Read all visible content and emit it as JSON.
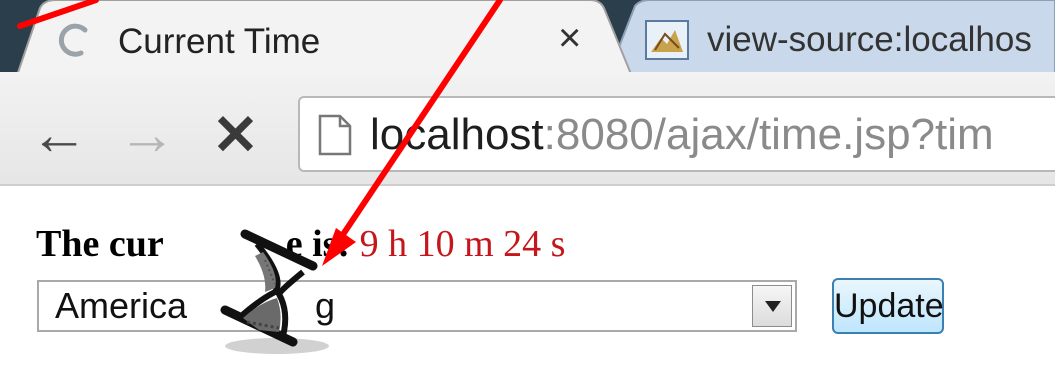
{
  "tabs": [
    {
      "title": "Current Time",
      "close_glyph": "×",
      "icon": "loading-spinner-icon"
    },
    {
      "title": "view-source:localhos",
      "icon": "page-favicon-icon"
    }
  ],
  "toolbar": {
    "back_glyph": "←",
    "forward_glyph": "→",
    "stop_glyph": "✕",
    "url_host": "localhost",
    "url_rest": ":8080/ajax/time.jsp?tim"
  },
  "page": {
    "time_label": "The cur",
    "time_label_tail": "e is:",
    "time_value": "9 h 10 m 24 s",
    "timezone_select_value": "America",
    "timezone_select_value_tail": "g",
    "update_label": "Update"
  },
  "overlay": {
    "cursor_icon": "hourglass-busy-icon",
    "annotation_color": "#ff0000"
  },
  "colors": {
    "time_value": "#c4161c",
    "update_button_border": "#3c7fb1",
    "background": "#2a3e4c"
  }
}
